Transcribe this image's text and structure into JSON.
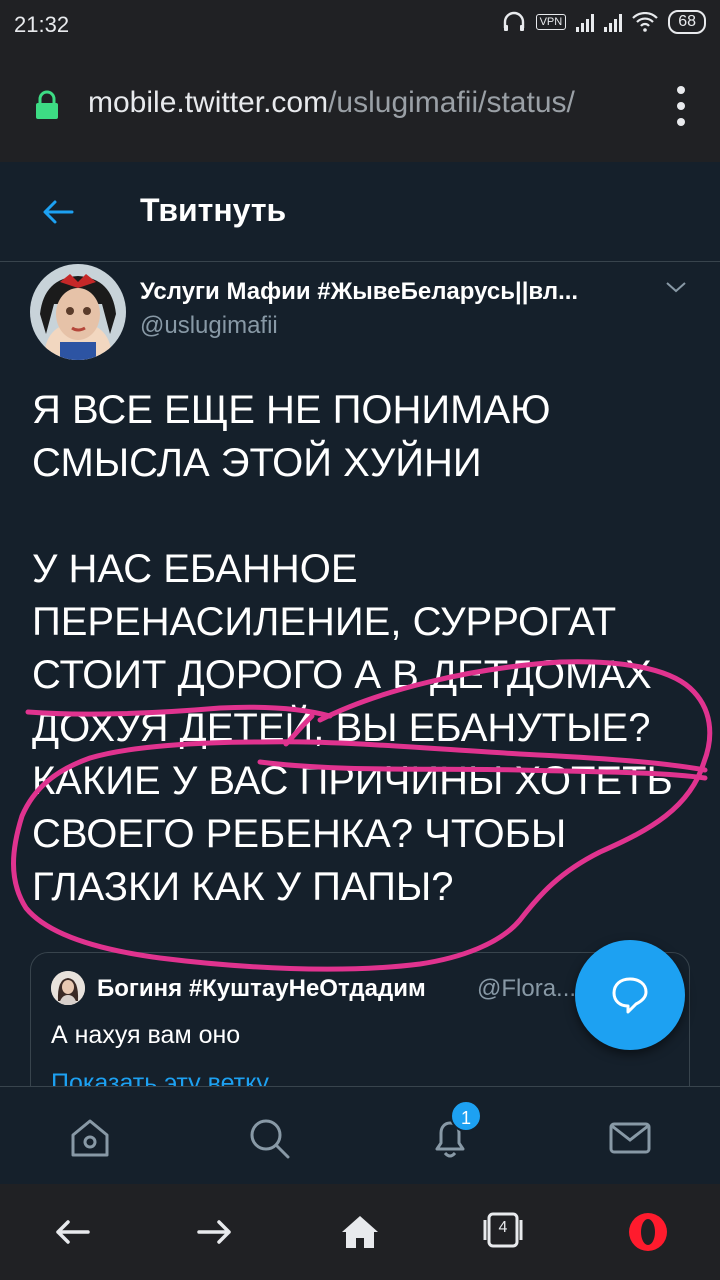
{
  "status_bar": {
    "time": "21:32",
    "vpn_label": "VPN",
    "battery": "68"
  },
  "browser": {
    "url_host": "mobile.twitter.com",
    "url_path": "/uslugimafii/status/"
  },
  "header": {
    "title": "Твитнуть"
  },
  "tweet": {
    "author_name": "Услуги Мафии #ЖывеБеларусь||вл...",
    "author_handle": "@uslugimafii",
    "text": "Я ВСЕ ЕЩЕ НЕ ПОНИМАЮ\nСМЫСЛА ЭТОЙ ХУЙНИ\n\nУ НАС ЕБАННОЕ\nПЕРЕНАСИЛЕНИЕ, СУРРОГАТ\nСТОИТ ДОРОГО А В ДЕТДОМАХ\nДОХУЯ ДЕТЕЙ, ВЫ ЕБАНУТЫЕ?\nКАКИЕ У ВАС ПРИЧИНЫ ХОТЕТЬ\nСВОЕГО РЕБЕНКА? ЧТОБЫ\nГЛАЗКИ КАК У ПАПЫ?"
  },
  "quoted_tweet": {
    "author_name": "Богиня #КуштауНеОтдадим",
    "author_handle": "@Flora...",
    "text": "А нахуя вам оно",
    "link": "Показать эту ветку"
  },
  "nav": {
    "notifications_badge": "1"
  },
  "browser_nav": {
    "tabs_count": "4"
  },
  "colors": {
    "background": "#15202b",
    "accent": "#1da1f2",
    "annotation": "#e0338f"
  }
}
